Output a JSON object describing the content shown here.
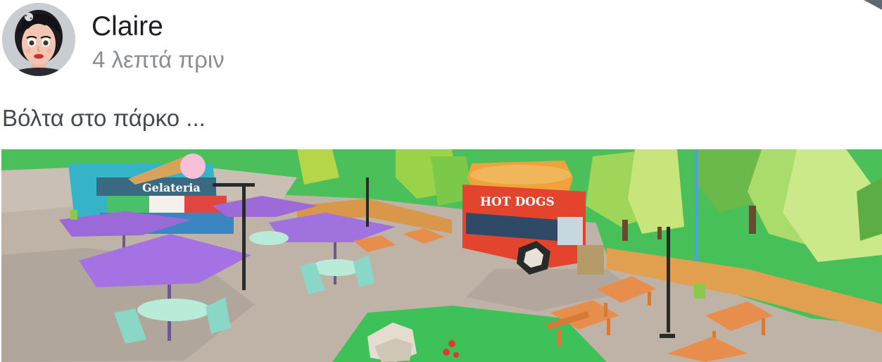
{
  "post": {
    "author": {
      "name": "Claire",
      "avatar_icon": "avatar-icon"
    },
    "timestamp": "4 λεπτά πριν",
    "text": "Βόλτα στο πάρκο ...",
    "menu_icon": "chevron-down-icon",
    "image": {
      "description_icon": "park-scene-image",
      "signs": {
        "shop": "Gelateria",
        "truck": "HOT DOGS"
      }
    }
  },
  "colors": {
    "name_text": "#1c1e21",
    "timestamp_text": "#8a8d91",
    "body_text": "#444950",
    "background": "#ffffff"
  }
}
